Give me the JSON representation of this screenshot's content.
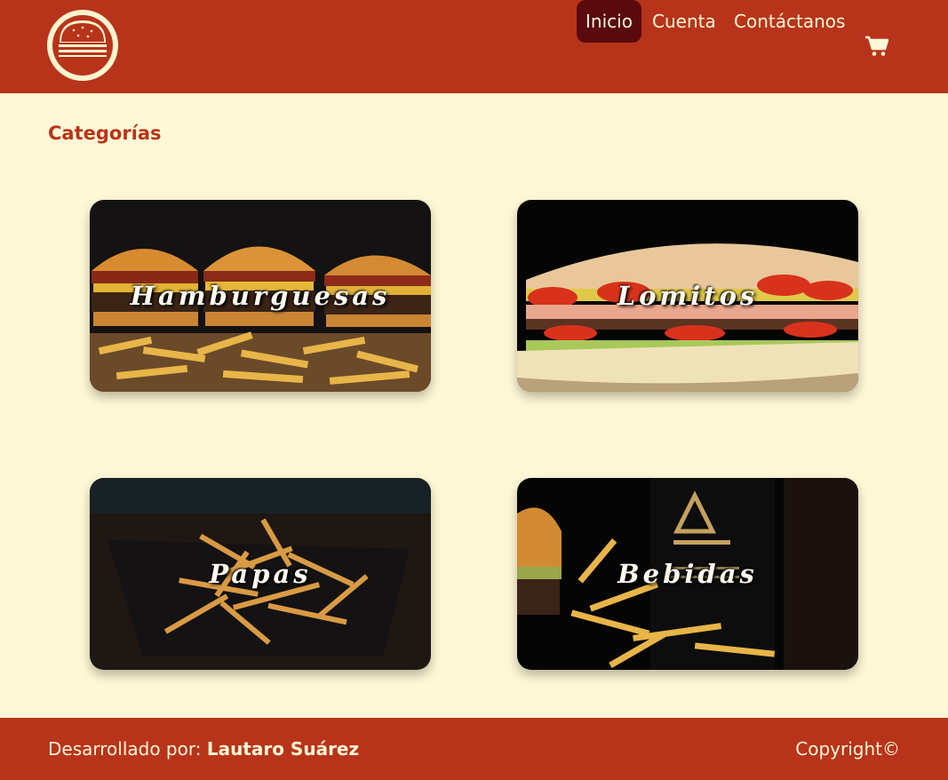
{
  "header": {
    "logo_icon": "burger-icon",
    "nav": [
      {
        "label": "Inicio",
        "active": true
      },
      {
        "label": "Cuenta",
        "active": false
      },
      {
        "label": "Contáctanos",
        "active": false
      }
    ],
    "cart_icon": "cart-icon",
    "colors": {
      "bar": "#b7341a",
      "active_pill": "#5a0a0f",
      "text": "#fff8d6"
    }
  },
  "main": {
    "title": "Categorías",
    "categories": [
      {
        "label": "Hamburguesas",
        "image": "burgers-and-fries"
      },
      {
        "label": "Lomitos",
        "image": "lomito-sandwich"
      },
      {
        "label": "Papas",
        "image": "fries-plate"
      },
      {
        "label": "Bebidas",
        "image": "beer-bottle-and-burger"
      }
    ]
  },
  "footer": {
    "prefix": "Desarrollado por: ",
    "author": "Lautaro Suárez",
    "copyright": "Copyright©"
  },
  "colors": {
    "background": "#fff8d6",
    "accent": "#b7341a"
  }
}
